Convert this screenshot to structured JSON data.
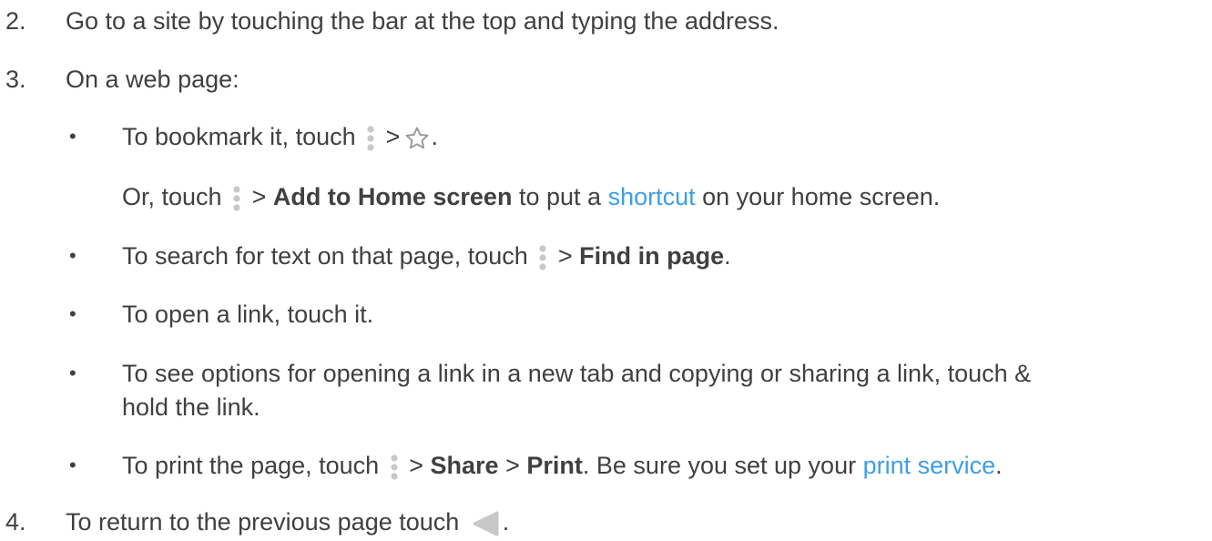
{
  "steps": {
    "s2": {
      "num": "2.",
      "text": "Go to a site by touching the bar at the top and typing the address."
    },
    "s3": {
      "num": "3.",
      "text": "On a web page:"
    },
    "s4": {
      "num": "4.",
      "text": "To return to the previous page touch",
      "end": "."
    }
  },
  "bullets": {
    "bookmark": {
      "bullet": "•",
      "pre": "To bookmark it, touch",
      "gt": ">",
      "end": "."
    },
    "home": {
      "pre": "Or, touch",
      "gt": ">",
      "bold": "Add to Home screen",
      "mid": "to put a",
      "link": "shortcut",
      "post": "on your home screen."
    },
    "find": {
      "bullet": "•",
      "pre": "To search for text on that page, touch",
      "gt": ">",
      "bold": "Find in page",
      "end": "."
    },
    "open": {
      "bullet": "•",
      "text": "To open a link, touch it."
    },
    "options": {
      "bullet": "•",
      "line1": "To see options for opening a link in a new tab and copying or sharing a link, touch &",
      "line2": "hold the link."
    },
    "print": {
      "bullet": "•",
      "pre": "To print the page, touch",
      "gt": ">",
      "bold1": "Share",
      "gt2": ">",
      "bold2": "Print",
      "mid": ". Be sure you set up your",
      "link": "print service",
      "end": "."
    }
  },
  "icons": {
    "menu": "more-vert-icon",
    "star": "star-outline-icon",
    "back": "back-triangle-icon"
  },
  "colors": {
    "text": "#404040",
    "link": "#3d9ee8",
    "icon_gray": "#c8c8c8"
  }
}
